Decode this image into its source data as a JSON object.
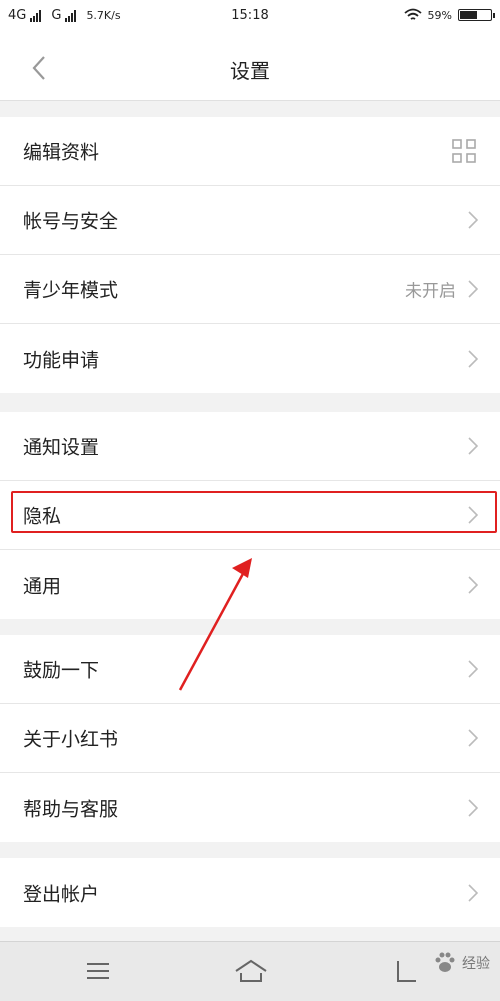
{
  "status_bar": {
    "network1": "4G",
    "network2": "G",
    "speed": "5.7K/s",
    "time": "15:18",
    "battery_text": "59%",
    "battery_level": 0.59
  },
  "header": {
    "title": "设置"
  },
  "sections": [
    {
      "items": [
        {
          "label": "编辑资料",
          "icon": "qr-code-icon"
        },
        {
          "label": "帐号与安全",
          "icon": "chevron-right-icon"
        },
        {
          "label": "青少年模式",
          "value": "未开启",
          "icon": "chevron-right-icon"
        },
        {
          "label": "功能申请",
          "icon": "chevron-right-icon"
        }
      ]
    },
    {
      "items": [
        {
          "label": "通知设置",
          "icon": "chevron-right-icon"
        },
        {
          "label": "隐私",
          "icon": "chevron-right-icon",
          "highlighted": true
        },
        {
          "label": "通用",
          "icon": "chevron-right-icon"
        }
      ]
    },
    {
      "items": [
        {
          "label": "鼓励一下",
          "icon": "chevron-right-icon"
        },
        {
          "label": "关于小红书",
          "icon": "chevron-right-icon"
        },
        {
          "label": "帮助与客服",
          "icon": "chevron-right-icon"
        }
      ]
    },
    {
      "items": [
        {
          "label": "登出帐户",
          "icon": "chevron-right-icon"
        }
      ]
    }
  ],
  "bottom_bar": {
    "watermark": "经验",
    "icons": [
      "menu-icon",
      "home-icon",
      "back-icon"
    ]
  },
  "colors": {
    "highlight": "#e02020",
    "background": "#f2f2f2"
  }
}
